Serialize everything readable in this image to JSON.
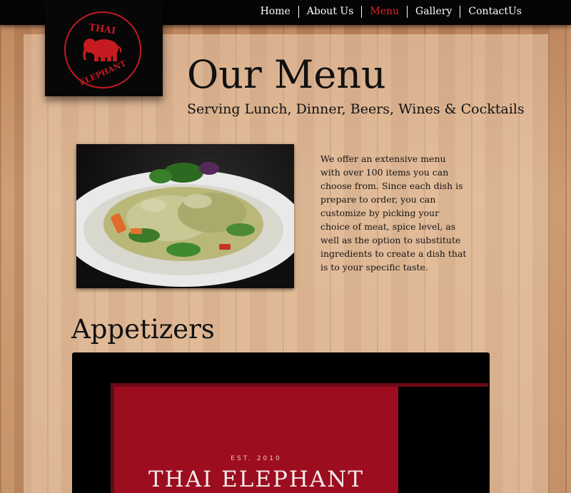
{
  "nav": {
    "items": [
      {
        "label": "Home",
        "active": false
      },
      {
        "label": "About Us",
        "active": false
      },
      {
        "label": "Menu",
        "active": true
      },
      {
        "label": "Gallery",
        "active": false
      },
      {
        "label": "ContactUs",
        "active": false
      }
    ],
    "active_color": "#e0212b"
  },
  "logo": {
    "word_top": "THAI",
    "word_bottom": "ELEPHANT",
    "color": "#c41a20"
  },
  "page": {
    "title": "Our Menu",
    "subtitle": "Serving Lunch, Dinner, Beers, Wines & Cocktails",
    "description": "We offer an extensive menu with over 100 items you can choose from. Since each dish is prepare to order, you can customize by picking your choice of meat, spice level, as well as the option to substitute ingredients to create a dish that is to your specific taste."
  },
  "section": {
    "heading": "Appetizers"
  },
  "embed": {
    "est": "EST. 2010",
    "name": "THAI ELEPHANT",
    "card_color": "#9c0d1f"
  }
}
